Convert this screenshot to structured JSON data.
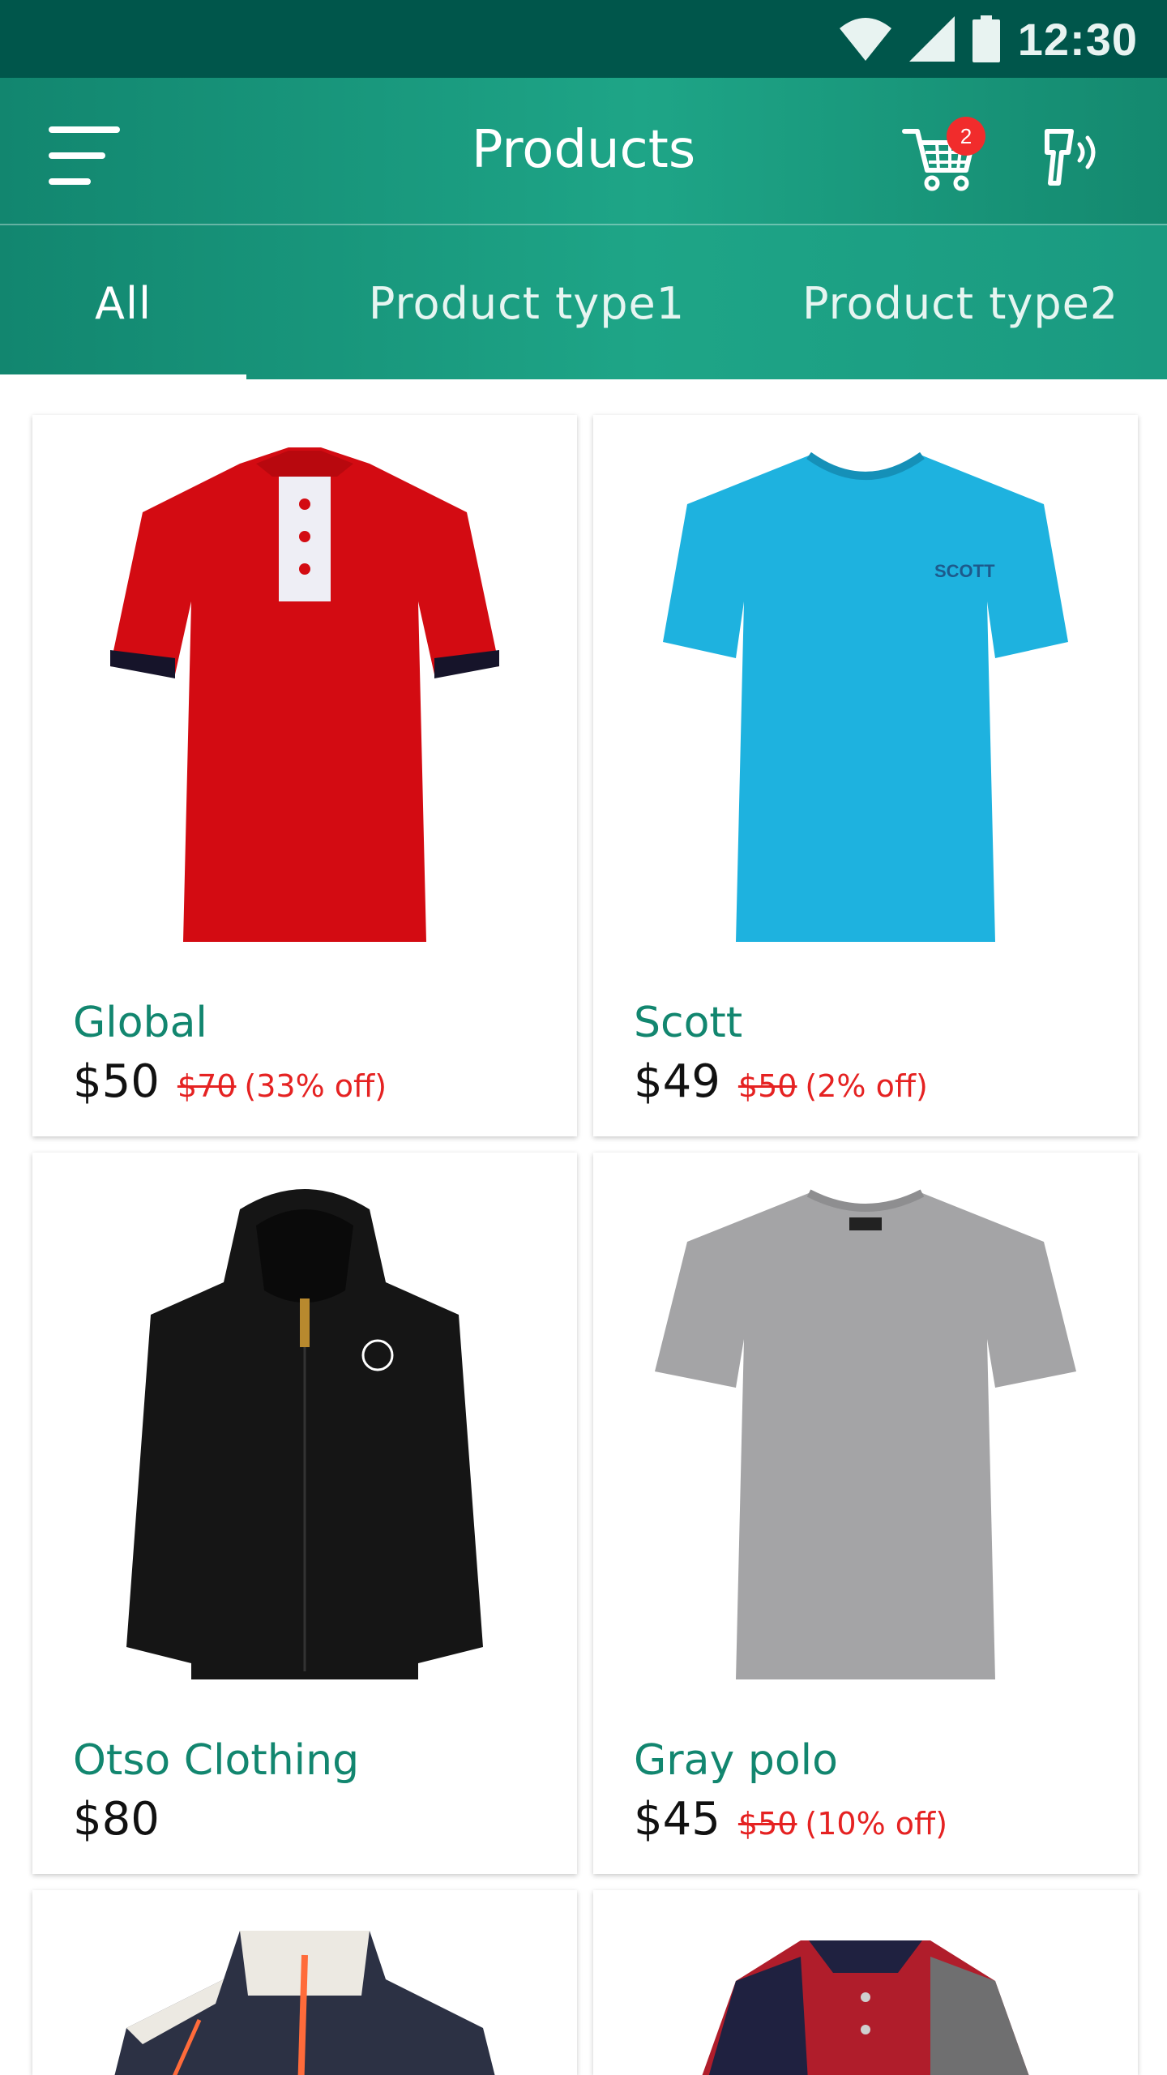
{
  "status_bar": {
    "time": "12:30",
    "icons": [
      "wifi-icon",
      "cellular-signal-icon",
      "battery-icon"
    ]
  },
  "app_bar": {
    "title": "Products",
    "menu_icon": "hamburger-menu-icon",
    "cart_icon": "shopping-cart-icon",
    "cart_badge": "2",
    "scan_icon": "barcode-scanner-icon"
  },
  "tabs": [
    {
      "label": "All",
      "active": true
    },
    {
      "label": "Product type1",
      "active": false
    },
    {
      "label": "Product type2",
      "active": false
    }
  ],
  "products": [
    {
      "name": "Global",
      "price": "$50",
      "old_price": "$70",
      "discount": "(33% off)",
      "image": "red-polo-shirt-image"
    },
    {
      "name": "Scott",
      "price": "$49",
      "old_price": "$50",
      "discount": "(2% off)",
      "image": "blue-tshirt-image"
    },
    {
      "name": "Otso Clothing",
      "price": "$80",
      "old_price": "",
      "discount": "",
      "image": "black-hoodie-image"
    },
    {
      "name": "Gray polo",
      "price": "$45",
      "old_price": "$50",
      "discount": "(10% off)",
      "image": "gray-tshirt-image"
    },
    {
      "name": "",
      "price": "",
      "old_price": "",
      "discount": "",
      "image": "white-navy-jacket-image"
    },
    {
      "name": "",
      "price": "",
      "old_price": "",
      "discount": "",
      "image": "red-navy-polo-image"
    }
  ],
  "colors": {
    "status_bar": "#00564b",
    "primary": "#1ea587",
    "accent_text": "#12866f",
    "discount_red": "#e52222",
    "badge_red": "#f12c2c"
  }
}
